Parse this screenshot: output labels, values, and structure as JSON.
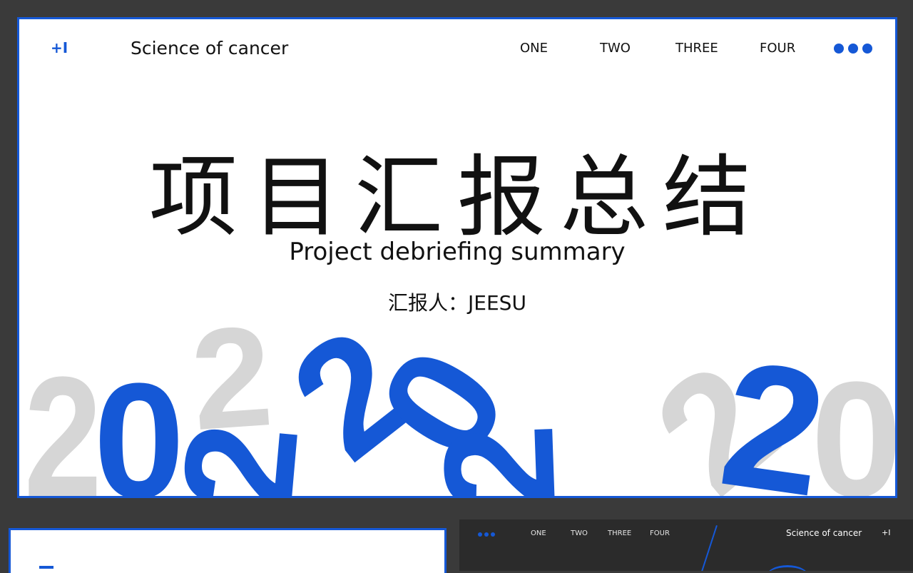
{
  "slide": {
    "brand_mark": "+I",
    "header_title": "Science of cancer",
    "nav": [
      "ONE",
      "TWO",
      "THREE",
      "FOUR"
    ],
    "main_title": "项目汇报总结",
    "subtitle": "Project debriefing summary",
    "presenter": "汇报人：JEESU"
  },
  "thumbnail_right": {
    "nav": [
      "ONE",
      "TWO",
      "THREE",
      "FOUR"
    ],
    "title": "Science of cancer",
    "brand_mark": "+I"
  },
  "colors": {
    "accent": "#1558d6",
    "gray_digits": "#d6d6d6",
    "frame_bg": "#3a3a3a",
    "dark_thumb_bg": "#2b2b2b"
  },
  "icons": [
    "more-dots-icon"
  ]
}
